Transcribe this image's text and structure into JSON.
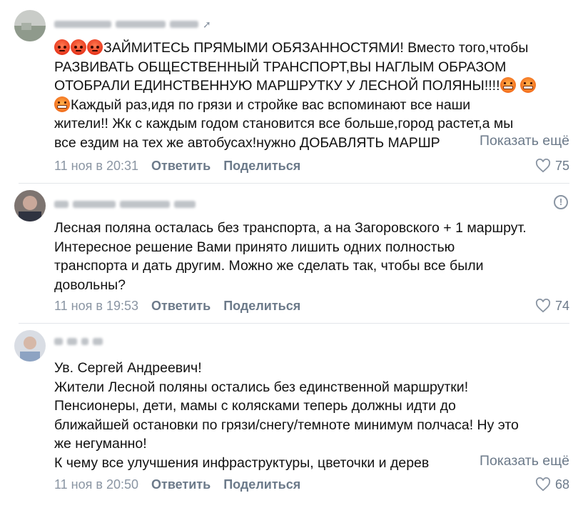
{
  "comments": [
    {
      "author_name": "",
      "avatar": "profile-photo",
      "paragraphs": [
        "ЗАЙМИТЕСЬ ПРЯМЫМИ ОБЯЗАННОСТЯМИ! Вместо того,чтобы",
        "РАЗВИВАТЬ ОБЩЕСТВЕННЫЙ ТРАНСПОРТ,ВЫ НАГЛЫМ ОБРАЗОМ",
        "ОТОБРАЛИ ЕДИНСТВЕННУЮ МАРШРУТКУ У ЛЕСНОЙ ПОЛЯНЫ!!!!",
        "Каждый раз,идя по грязи и стройке вас вспоминают все наши",
        "жители!! Жк с каждым годом становится все больше,город растет,а мы",
        "все ездим на тех же автобусах!нужно ДОБАВЛЯТЬ МАРШР"
      ],
      "show_more": "Показать ещё",
      "date": "11 ноя в 20:31",
      "reply_label": "Ответить",
      "share_label": "Поделиться",
      "likes": "75"
    },
    {
      "author_name": "",
      "avatar": "profile-photo",
      "paragraphs": [
        "Лесная поляна осталась без транспорта, а на Загоровского + 1 маршрут.",
        "Интересное решение Вами принято лишить одних полностью",
        "транспорта и дать другим. Можно же сделать так, чтобы все были",
        "довольны?"
      ],
      "date": "11 ноя в 19:53",
      "reply_label": "Ответить",
      "share_label": "Поделиться",
      "likes": "74",
      "report_icon": "!"
    },
    {
      "author_name": "",
      "avatar": "profile-photo",
      "paragraphs": [
        "Ув. Сергей Андреевич!",
        "Жители Лесной поляны остались без единственной маршрутки!",
        "Пенсионеры, дети, мамы с колясками теперь должны идти до",
        "ближайшей остановки по грязи/снегу/темноте минимум полчаса! Ну это",
        "же негуманно!",
        "К чему все улучшения инфраструктуры, цветочки и дерев"
      ],
      "show_more": "Показать ещё",
      "date": "11 ноя в 20:50",
      "reply_label": "Ответить",
      "share_label": "Поделиться",
      "likes": "68"
    }
  ],
  "colors": {
    "accent": "#6c7a8a",
    "meta": "#8a95a3",
    "divider": "#e3e6ea"
  },
  "icons": {
    "like": "heart-icon",
    "report": "exclamation-circle-icon",
    "angry_emoji": "angry-face-emoji",
    "fume_emoji": "grimace-face-emoji"
  }
}
